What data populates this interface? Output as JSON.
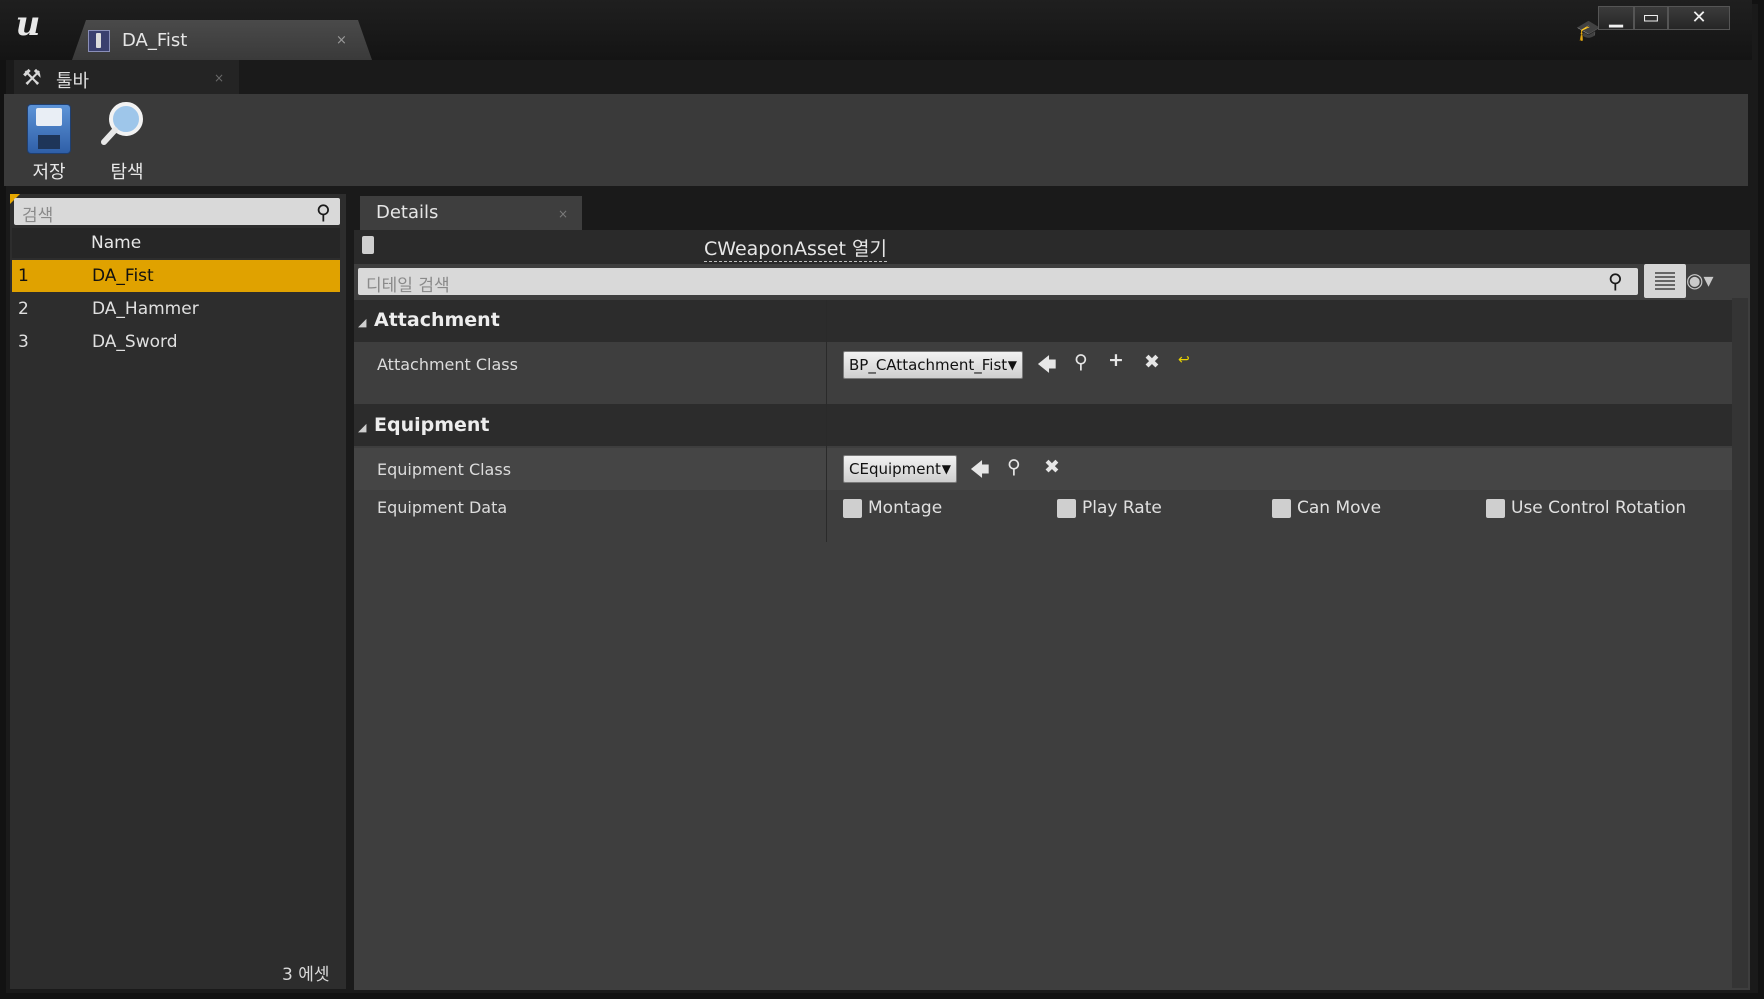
{
  "title_tab": {
    "label": "DA_Fist",
    "close": "×"
  },
  "toolbar_tab": {
    "label": "툴바",
    "close": "×"
  },
  "toolbar": {
    "save_label": "저장",
    "browse_label": "탐색"
  },
  "asset_list": {
    "search_placeholder": "검색",
    "column_header": "Name",
    "rows": [
      {
        "index": "1",
        "name": "DA_Fist",
        "selected": true
      },
      {
        "index": "2",
        "name": "DA_Hammer",
        "selected": false
      },
      {
        "index": "3",
        "name": "DA_Sword",
        "selected": false
      }
    ],
    "count": "3 에셋"
  },
  "details": {
    "tab_label": "Details",
    "tab_close": "×",
    "open_link": "CWeaponAsset 열기",
    "search_placeholder": "디테일 검색",
    "categories": {
      "attachment": {
        "label": "Attachment",
        "attachment_class_label": "Attachment Class",
        "attachment_class_value": "BP_CAttachment_Fist"
      },
      "equipment": {
        "label": "Equipment",
        "equipment_class_label": "Equipment Class",
        "equipment_class_value": "CEquipment",
        "equipment_data_label": "Equipment Data",
        "checkboxes": [
          "Montage",
          "Play Rate",
          "Can Move",
          "Use Control Rotation"
        ]
      }
    }
  },
  "colors": {
    "accent": "#e0a200",
    "panel": "#3e3e3e",
    "category": "#2c2c2c"
  },
  "icons": [
    "unreal-logo-icon",
    "asset-icon",
    "tools-icon",
    "save-icon",
    "browse-icon",
    "search-icon",
    "grid-view-icon",
    "eye-icon",
    "arrow-left-icon",
    "browse-magnifier-icon",
    "plus-icon",
    "clear-x-icon",
    "reset-arrow-icon",
    "graduation-cap-icon",
    "minimize-icon",
    "maximize-icon",
    "close-icon"
  ]
}
